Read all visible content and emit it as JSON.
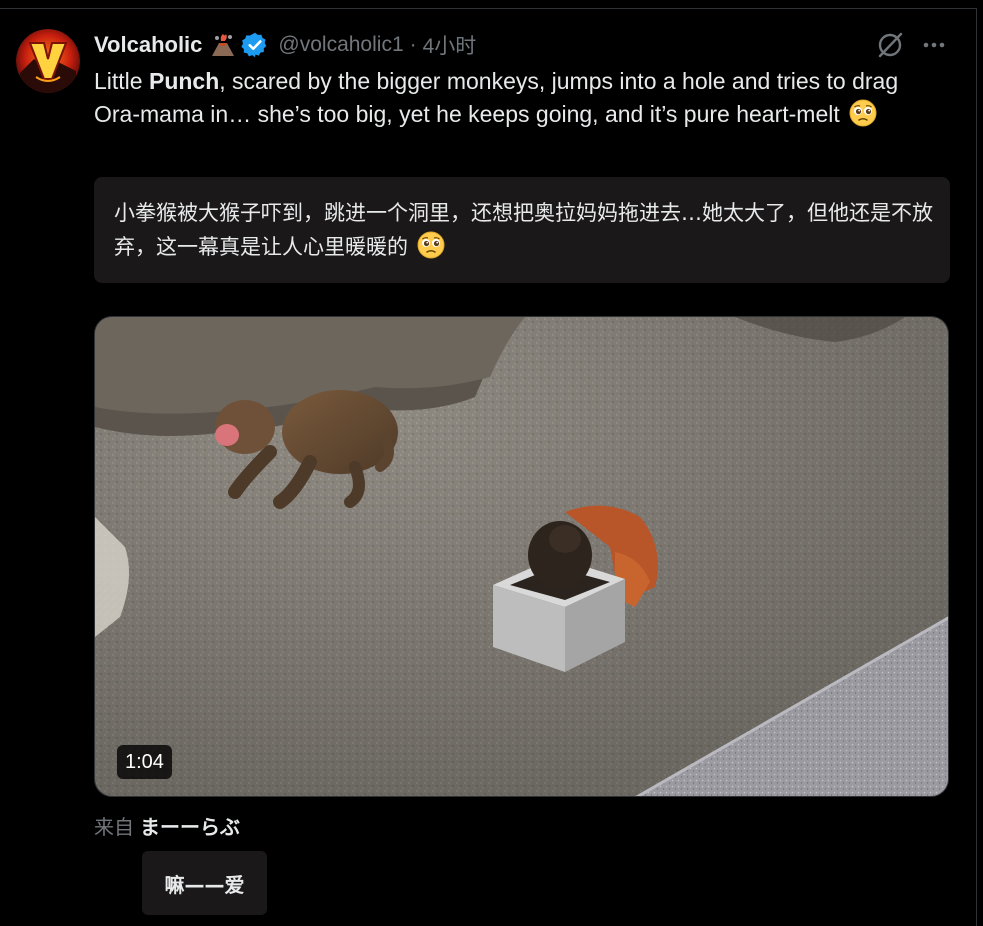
{
  "post": {
    "display_name": "Volcaholic",
    "handle": "@volcaholic1",
    "separator": "·",
    "time": "4小时",
    "text_segments": [
      "Little ",
      "Punch",
      ", scared by the bigger monkeys, jumps into a hole and tries to drag Ora-mama in… she’s too big, yet he keeps going, and it’s pure heart-melt"
    ],
    "translation": "小拳猴被大猴子吓到，跳进一个洞里，还想把奥拉妈妈拖进去…她太大了，但他还是不放弃，这一幕真是让人心里暖暖的",
    "video": {
      "duration": "1:04"
    },
    "source": {
      "label": "来自",
      "name": "まーーらぶ"
    },
    "chip_label": "嘛——爱"
  },
  "icons": {
    "avatar": "volcano-logo-avatar",
    "name_emoji": "volcano-emoji",
    "verified": "verified-badge-icon",
    "grok": "grok-icon",
    "more": "more-icon",
    "text_emoji": "pleading-face-emoji"
  },
  "colors": {
    "background": "#000000",
    "text": "#e7e9ea",
    "muted": "#71767b",
    "verified": "#1d9bf0",
    "card": "#1a1818"
  }
}
